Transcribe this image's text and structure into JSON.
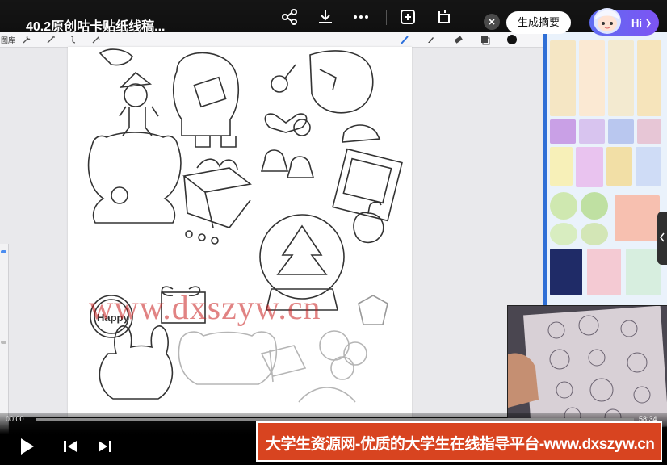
{
  "header": {
    "title": "40.2原创咕卡贴纸线稿...",
    "icons": [
      "share-icon",
      "download-icon",
      "more-icon",
      "screenshot-icon",
      "popout-icon"
    ],
    "summary_button": "生成摘要",
    "assistant_greeting": "Hi"
  },
  "app_toolbar": {
    "gallery_label": "图库",
    "tools": [
      "wrench-icon",
      "magic-wand-icon",
      "selection-icon",
      "transform-icon",
      "brush-icon",
      "smudge-icon",
      "eraser-icon",
      "layers-icon",
      "color-icon"
    ]
  },
  "watermark": "www.dxszyw.cn",
  "canvas_text": {
    "happy": "Happy"
  },
  "player": {
    "current_time": "00:00",
    "end_time": "58:34",
    "controls": [
      "play-icon",
      "previous-icon",
      "next-icon"
    ]
  },
  "banner": {
    "text": "大学生资源网-优质的大学生在线指导平台-www.dxszyw.cn"
  },
  "colors": {
    "banner": "#d84420",
    "ref_border": "#2f6fd6",
    "summary_bg": "#ffffff",
    "hi_pill": "#6a62f2"
  }
}
